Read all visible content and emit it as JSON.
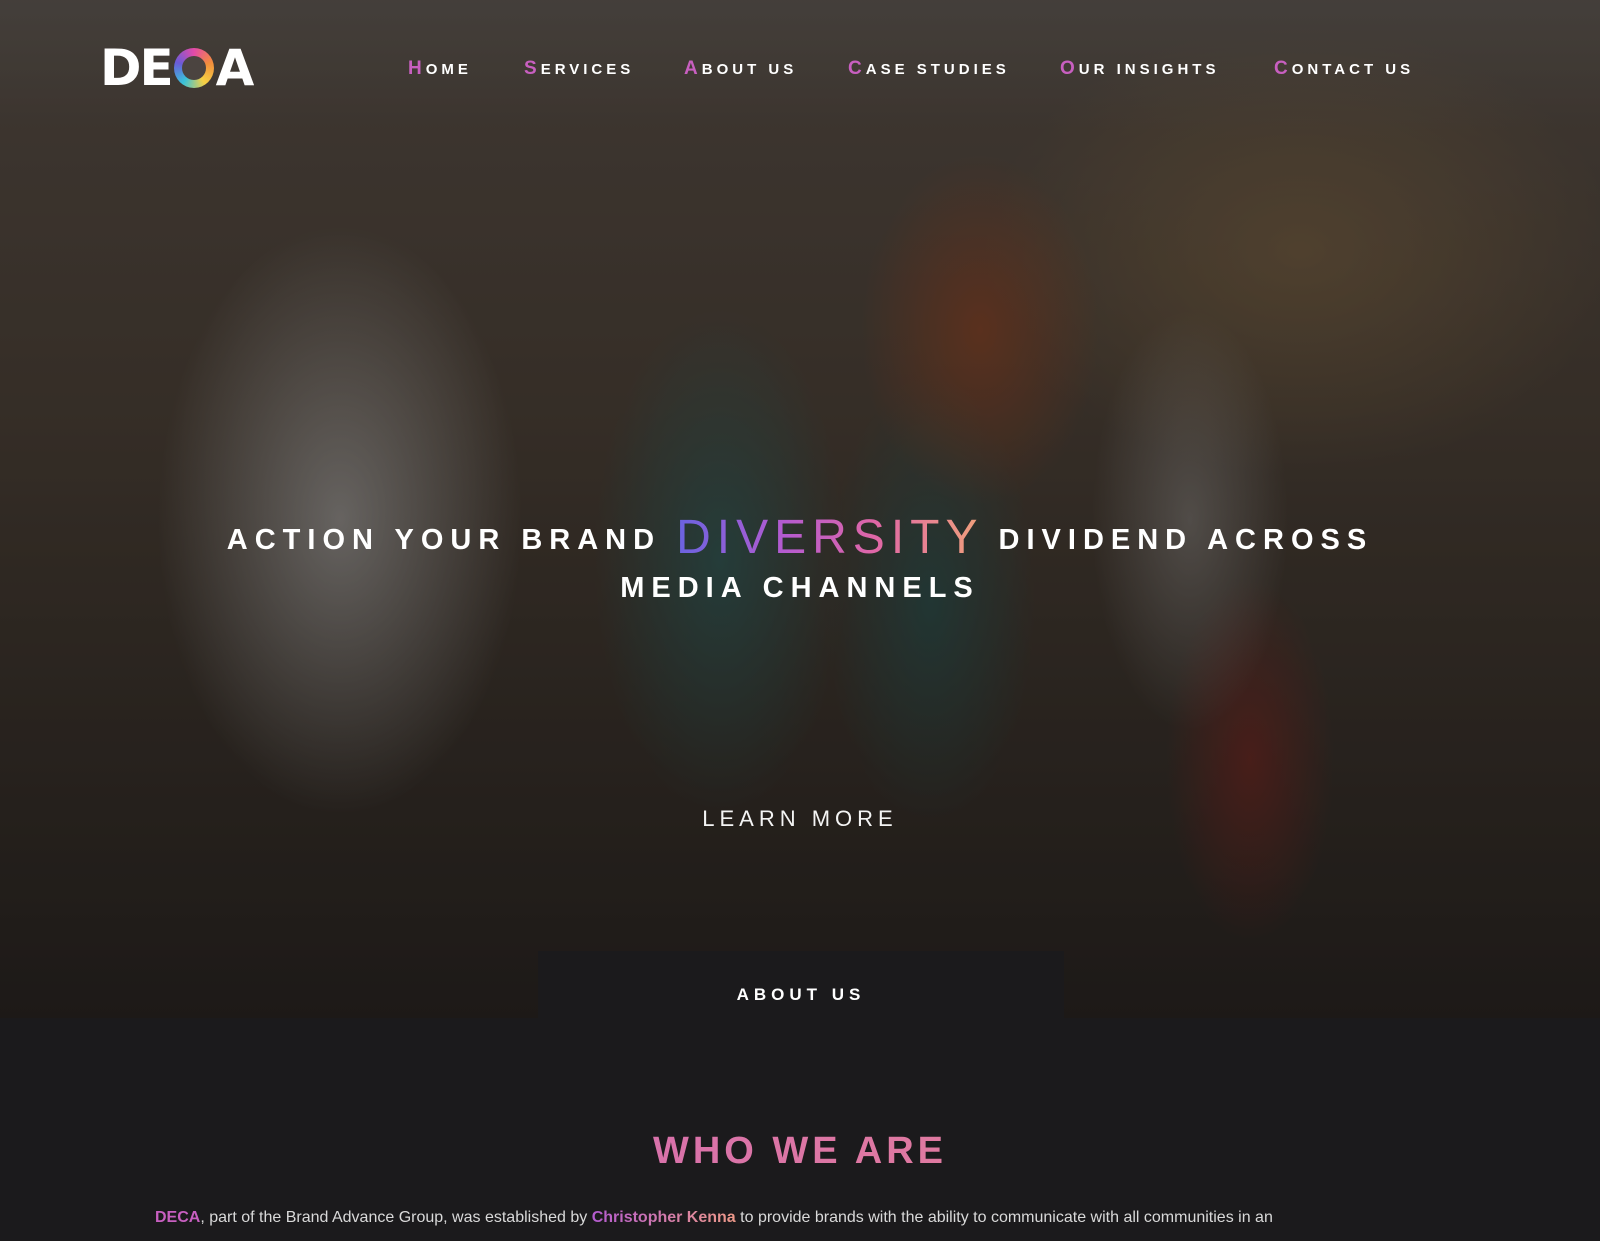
{
  "logo": {
    "letters_left": "DE",
    "letters_right": "A"
  },
  "nav": {
    "items": [
      {
        "first": "H",
        "rest": "ome"
      },
      {
        "first": "S",
        "rest": "ervices"
      },
      {
        "first": "A",
        "rest": "bout us"
      },
      {
        "first": "C",
        "rest": "ase studies"
      },
      {
        "first": "O",
        "rest": "ur insights"
      },
      {
        "first": "C",
        "rest": "ontact us"
      }
    ]
  },
  "hero": {
    "line1_before": "ACTION YOUR BRAND ",
    "accent": "DIVERSITY",
    "line1_after": " DIVIDEND ACROSS",
    "line2": "MEDIA CHANNELS",
    "cta": "LEARN MORE"
  },
  "about_tab": "ABOUT US",
  "section": {
    "heading": "WHO WE ARE",
    "intro_brand": "DECA",
    "intro_part1": ", part of the Brand Advance Group, was established by ",
    "intro_founder": "Christopher Kenna",
    "intro_part2": " to provide brands with the ability to communicate with all communities in an"
  },
  "colors": {
    "accent": "#c85fc0",
    "background": "#1b1a1c"
  }
}
